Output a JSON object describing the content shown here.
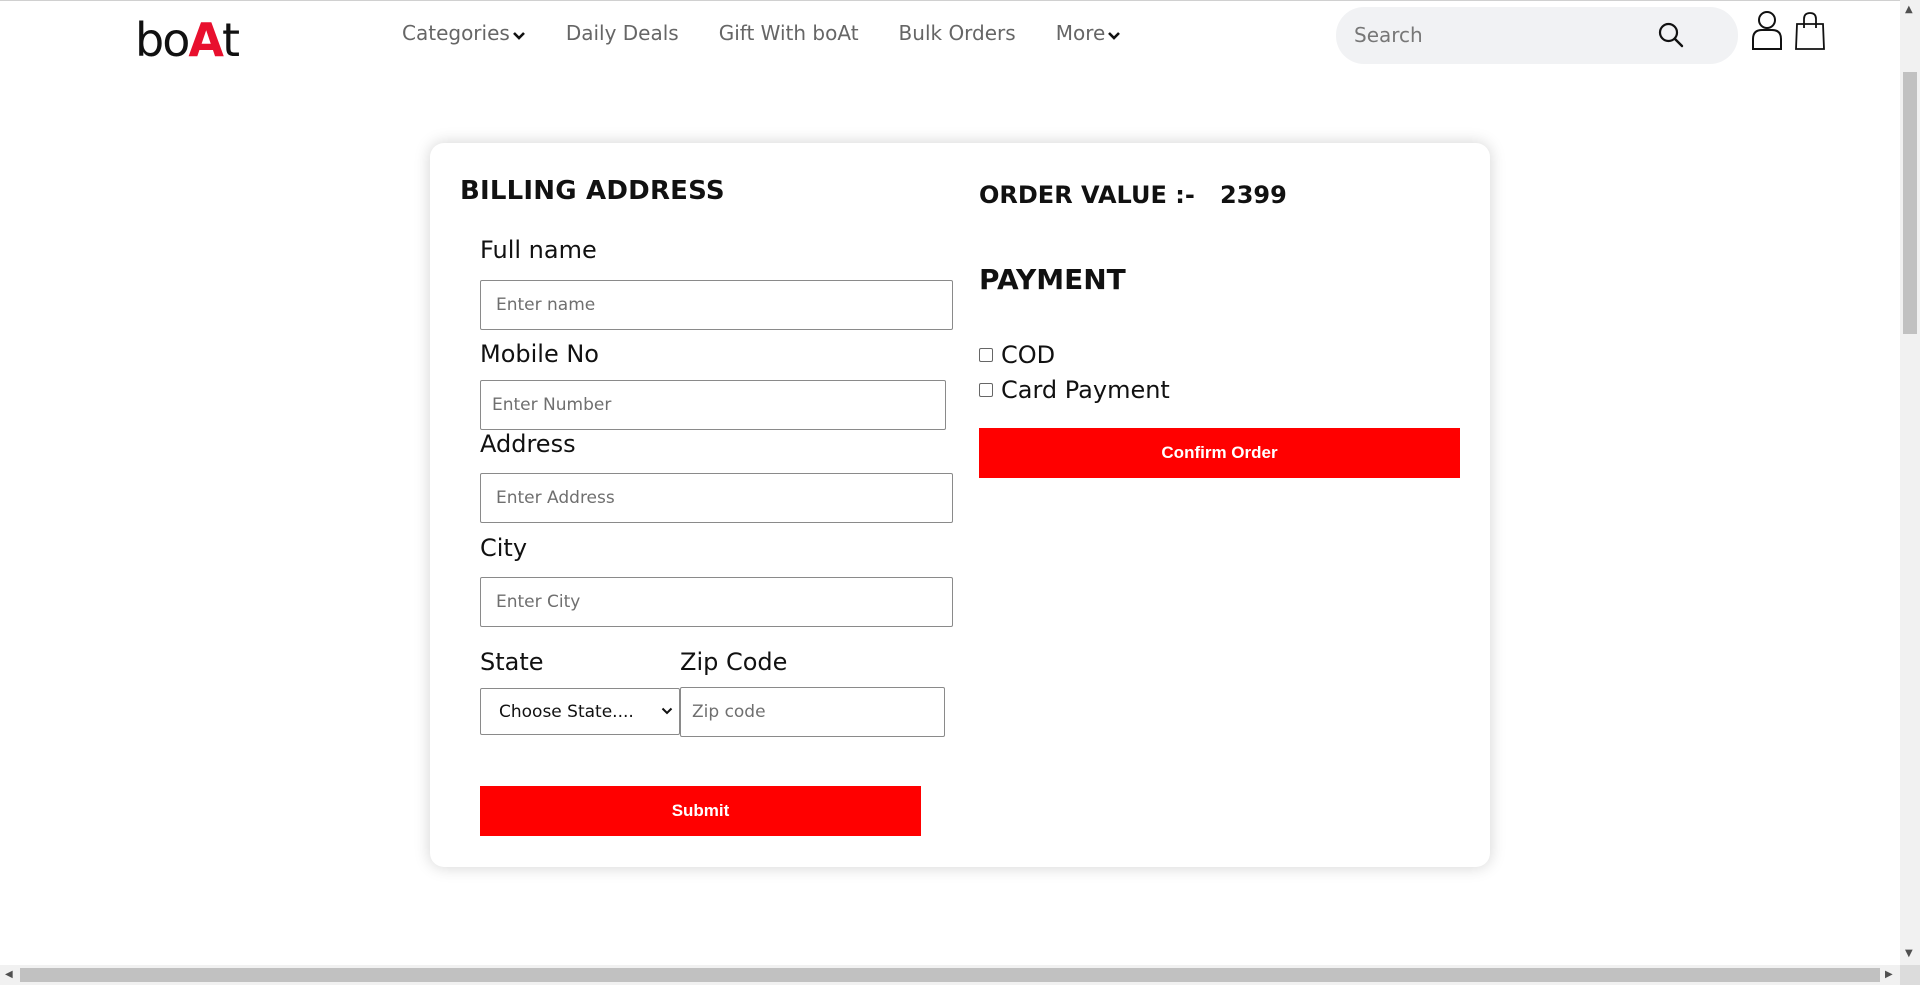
{
  "header": {
    "logo": {
      "pre": "bo",
      "accent": "A",
      "post": "t"
    },
    "nav": [
      {
        "label": "Categories",
        "has_dropdown": true
      },
      {
        "label": "Daily Deals",
        "has_dropdown": false
      },
      {
        "label": "Gift With boAt",
        "has_dropdown": false
      },
      {
        "label": "Bulk Orders",
        "has_dropdown": false
      },
      {
        "label": "More",
        "has_dropdown": true
      }
    ],
    "search": {
      "placeholder": "Search"
    }
  },
  "billing": {
    "title": "BILLING ADDRESS",
    "full_name": {
      "label": "Full name",
      "placeholder": "Enter name"
    },
    "mobile": {
      "label": "Mobile No",
      "placeholder": "Enter Number"
    },
    "address": {
      "label": "Address",
      "placeholder": "Enter Address"
    },
    "city": {
      "label": "City",
      "placeholder": "Enter City"
    },
    "state": {
      "label": "State",
      "selected": "Choose State...."
    },
    "zip": {
      "label": "Zip Code",
      "placeholder": "Zip code"
    },
    "submit_label": "Submit"
  },
  "order": {
    "label": "ORDER VALUE :-",
    "value": "2399"
  },
  "payment": {
    "title": "PAYMENT",
    "options": [
      {
        "label": "COD",
        "checked": false
      },
      {
        "label": "Card Payment",
        "checked": false
      }
    ],
    "confirm_label": "Confirm Order"
  },
  "colors": {
    "accent": "#ff0000",
    "logo_accent": "#e8102e",
    "nav_text": "#666666",
    "search_bg": "#f1f2f4"
  }
}
